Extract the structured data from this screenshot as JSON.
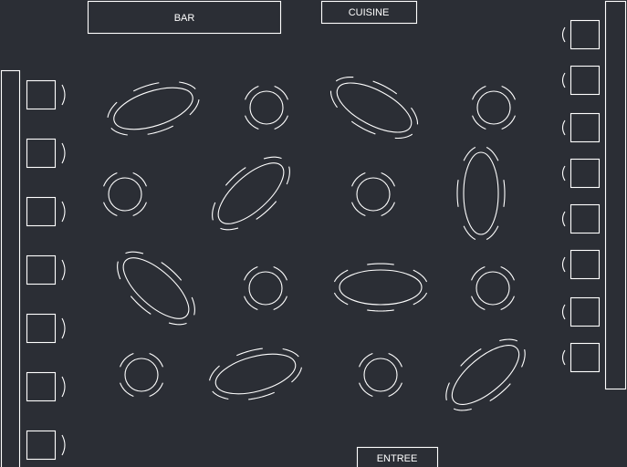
{
  "labels": {
    "bar": "BAR",
    "kitchen": "CUISINE",
    "entrance": "ENTREE"
  },
  "colors": {
    "background": "#2b2e35",
    "lines": "#ffffff"
  }
}
